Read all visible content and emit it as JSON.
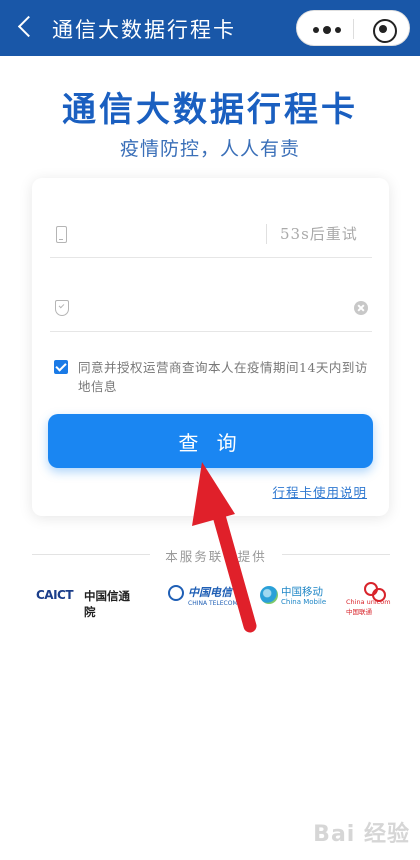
{
  "topbar": {
    "title": "通信大数据行程卡"
  },
  "header": {
    "title": "通信大数据行程卡",
    "subtitle": "疫情防控，人人有责"
  },
  "form": {
    "phone_value": "",
    "resend_label": "53s后重试",
    "code_value": "",
    "agreement_text": "同意并授权运营商查询本人在疫情期间14天内到访地信息",
    "agreement_checked": true,
    "query_button_label": "查 询",
    "guide_link": "行程卡使用说明"
  },
  "providers": {
    "title": "本服务联合提供",
    "logos": [
      {
        "name": "CAICT",
        "mark": "CAICT",
        "cn": "中国信通院"
      },
      {
        "name": "China Telecom",
        "cn": "中国电信",
        "en": "CHINA TELECOM"
      },
      {
        "name": "China Mobile",
        "cn": "中国移动",
        "en": "China Mobile"
      },
      {
        "name": "China Unicom",
        "en": "China unicom中国联通"
      }
    ]
  },
  "watermark": "Bai 经验",
  "colors": {
    "topbar": "#1957a8",
    "headline": "#1a5fc0",
    "button": "#1a86f2",
    "arrow": "#e0202a"
  }
}
